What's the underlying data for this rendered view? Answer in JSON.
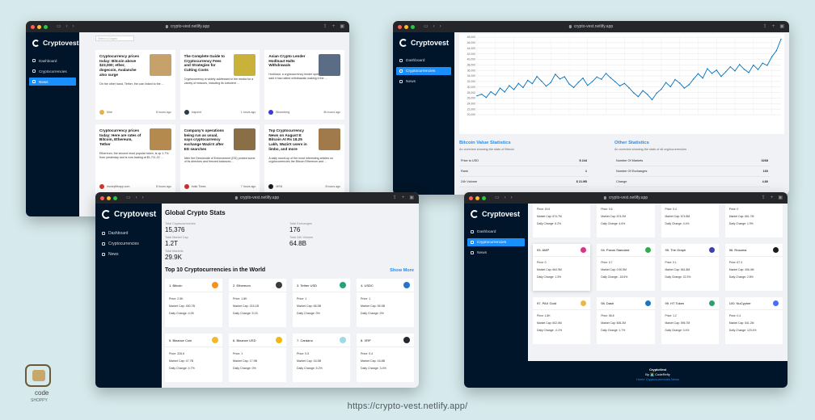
{
  "site_url": "https://crypto-vest.netlify.app/",
  "badge": {
    "label": "code",
    "sub": "SHOPPY"
  },
  "browser": {
    "url": "crypto-vest.netlify.app"
  },
  "brand": "Cryptovest",
  "menu": {
    "dashboard": "Dashboard",
    "cryptocurrencies": "Cryptocurrencies",
    "news": "News"
  },
  "news": {
    "select_placeholder": "Select a Crypto",
    "cards": [
      {
        "title": "Cryptocurrency prices today: Bitcoin above $23,000; ether, dogecoin, Avalanche also surge",
        "desc": "On the other hand, Tether, the coin linked to the ...",
        "provider": "Mint",
        "time": "8 hours ago",
        "thumb": "#c7a16a",
        "pav": "#e8b04a"
      },
      {
        "title": "The Complete Guide to Cryptocurrency Fees and Strategies for Cutting Costs",
        "desc": "Cryptocurrency is widely addressed in the media for a variety of reasons, including its turbulent ...",
        "provider": "Inspoint",
        "time": "1 hours ago",
        "thumb": "#c9b23a",
        "pav": "#2d3a48"
      },
      {
        "title": "Asian Crypto Lender Hodlnaut Halts Withdrawals",
        "desc": "Hodlnaut, a cryptocurrency lender operating in Asia, said it has halted withdrawals making it the ...",
        "provider": "Bloomberg",
        "time": "8h hours ago",
        "thumb": "#5a6d84",
        "pav": "#3b3bd6"
      },
      {
        "title": "Cryptocurrency prices today: Here are rates of Bitcoin, Ethereum, Tether",
        "desc": "Ethereum, the second most popular token, is up 1.7% from yesterday and is now trading at $1,711.22 ...",
        "provider": "moneylifeapp.com",
        "time": "8 hours ago",
        "thumb": "#b58a4e",
        "pav": "#d03a2a"
      },
      {
        "title": "Company's operations being run as usual, says cryptocurrency exchange WazirX after ED searches",
        "desc": "After the Directorate of Enforcement (ED) probed some of its directors and freezed balances ...",
        "provider": "India Times",
        "time": "7 hours ago",
        "thumb": "#8a6e45",
        "pav": "#c7332c"
      },
      {
        "title": "Top Cryptocurrency News on August 8: Bitcoin At Rs 18.25 Lakh, WazirX users in limbo, and more",
        "desc": "A daily round-up of the most interesting articles on cryptocurrencies the Bitcoin Ethereum and ...",
        "provider": "MSN",
        "time": "8 hours ago",
        "thumb": "#a07a4a",
        "pav": "#1a1a1a"
      }
    ]
  },
  "chart_data": {
    "type": "line",
    "title": "",
    "xlabel": "",
    "ylabel": "",
    "ylim": [
      20000,
      48000
    ],
    "yticks": [
      "48,000",
      "46,000",
      "44,000",
      "42,000",
      "40,000",
      "38,000",
      "36,000",
      "34,000",
      "32,000",
      "30,000",
      "28,000",
      "26,000",
      "24,000",
      "22,000",
      "20,000"
    ],
    "series": [
      {
        "values": [
          26800,
          27400,
          26200,
          28300,
          27100,
          29600,
          28200,
          30500,
          29100,
          31300,
          29800,
          32400,
          31200,
          33800,
          32100,
          30300,
          31600,
          34600,
          32900,
          33700,
          31100,
          29800,
          31700,
          33200,
          30600,
          31900,
          33600,
          32800,
          34900,
          33300,
          31900,
          30400,
          31300,
          29700,
          27900,
          26500,
          28700,
          27300,
          25400,
          27800,
          29200,
          31600,
          30100,
          32700,
          31400,
          29600,
          30800,
          32900,
          34800,
          33200,
          36600,
          34900,
          36100,
          33800,
          35500,
          37300,
          35800,
          38100,
          36400,
          35200,
          37900,
          36300,
          38600,
          37800,
          40900,
          43100,
          47300
        ]
      }
    ]
  },
  "bitcoin_stats": {
    "title": "Bitcoin Value Statistics",
    "subtitle": "An overview showing the stats of Bitcoin",
    "rows": [
      {
        "label": "Price to USD",
        "value": "$ 244"
      },
      {
        "label": "Rank",
        "value": "1"
      },
      {
        "label": "24h Volume",
        "value": "$ 21.9B"
      }
    ]
  },
  "other_stats": {
    "title": "Other Statistics",
    "subtitle": "An overview showing the stats of all cryptocurrencies",
    "rows": [
      {
        "label": "Number Of Markets",
        "value": "3268"
      },
      {
        "label": "Number Of Exchanges",
        "value": "160"
      },
      {
        "label": "Change",
        "value": "4.80"
      }
    ]
  },
  "global": {
    "title": "Global Crypto Stats",
    "total_crypto_label": "Total Cryptocurrencies",
    "total_crypto": "15,376",
    "total_exchanges_label": "Total Exchanges",
    "total_exchanges": "176",
    "total_mcap_label": "Total Market Cap",
    "total_mcap": "1.2T",
    "total_24h_label": "Total 24h Volume",
    "total_24h": "64.8B",
    "total_markets_label": "Total Markets",
    "total_markets": "29.9K",
    "top10_title": "Top 10 Cryptocurrencies in the World",
    "show_more": "Show More",
    "coins": [
      {
        "name": "1. Bitcoin",
        "price": "Price: 2.5K",
        "mcap": "Market Cap: 450.7B",
        "change": "Daily Change: 4.05",
        "color": "#f7931a"
      },
      {
        "name": "2. Ethereum",
        "price": "Price: 1.8K",
        "mcap": "Market Cap: 215.1B",
        "change": "Daily Change: 5.15",
        "color": "#3c3c3d"
      },
      {
        "name": "3. Tether USD",
        "price": "Price: 1",
        "mcap": "Market Cap: 66.5B",
        "change": "Daily Change: 0%",
        "color": "#26a17b"
      },
      {
        "name": "4. USDC",
        "price": "Price: 1",
        "mcap": "Market Cap: 55.9B",
        "change": "Daily Change: 0%",
        "color": "#2775ca"
      },
      {
        "name": "5. Binance Coin",
        "price": "Price: 326.6",
        "mcap": "Market Cap: 47.7B",
        "change": "Daily Change: 4.7%",
        "color": "#f3ba2f"
      },
      {
        "name": "6. Binance USD",
        "price": "Price: 1",
        "mcap": "Market Cap: 17.9B",
        "change": "Daily Change: 0%",
        "color": "#f0b90b"
      },
      {
        "name": "7. Cardano",
        "price": "Price: 0.5",
        "mcap": "Market Cap: 16.5B",
        "change": "Daily Change: 5.2%",
        "color": "#9ed9e6"
      },
      {
        "name": "8. XRP",
        "price": "Price: 0.4",
        "mcap": "Market Cap: 16.8B",
        "change": "Daily Change: 3.4%",
        "color": "#23292f"
      }
    ]
  },
  "top100": {
    "cards": [
      {
        "name": "",
        "price": "Price: 15.6",
        "mcap": "Market Cap: 674.7M",
        "change": "Daily Change: 6.2%",
        "color": "",
        "top": true
      },
      {
        "name": "",
        "price": "Price: 0.6",
        "mcap": "Market Cap: 674.2M",
        "change": "Daily Change: 4.6%",
        "color": "",
        "top": true
      },
      {
        "name": "",
        "price": "Price: 0.4",
        "mcap": "Market Cap: 674.8M",
        "change": "Daily Change: 4.4%",
        "color": "",
        "top": true
      },
      {
        "name": "",
        "price": "Price: 0",
        "mcap": "Market Cap: 661.7M",
        "change": "Daily Change: 1.9%",
        "color": "",
        "top": true
      },
      {
        "name": "93. AMP",
        "price": "Price: 0",
        "mcap": "Market Cap: 664.9M",
        "change": "Daily Change: 1.3%",
        "color": "#d9348b",
        "hl": true
      },
      {
        "name": "94. Paxos Standard",
        "price": "Price: 0.7",
        "mcap": "Market Cap: 0.50.5M",
        "change": "Daily Change: -18.6%",
        "color": "#34a853"
      },
      {
        "name": "95. The Graph",
        "price": "Price: 0.1",
        "mcap": "Market Cap: 661.8M",
        "change": "Daily Change: 22.3%",
        "color": "#3f3fb5"
      },
      {
        "name": "96. Rosama",
        "price": "Price: 67.3",
        "mcap": "Market Cap: 406.4M",
        "change": "Daily Change: 2.8%",
        "color": "#1b1b1b"
      },
      {
        "name": "97. PAX Gold",
        "price": "Price: 1.8K",
        "mcap": "Market Cap: 602.6M",
        "change": "Daily Change: -0.2%",
        "color": "#e8b84a"
      },
      {
        "name": "98. Dash",
        "price": "Price: 56.8",
        "mcap": "Market Cap: 606.2M",
        "change": "Daily Change: 1.7%",
        "color": "#1c75bc"
      },
      {
        "name": "99. HT Token",
        "price": "Price: 1.2",
        "mcap": "Market Cap: 596.7M",
        "change": "Daily Change: 0.4%",
        "color": "#2ea06e"
      },
      {
        "name": "100. NuCypher",
        "price": "Price: 0.4",
        "mcap": "Market Cap: 541.2M",
        "change": "Daily Change: 123.4%",
        "color": "#4a6cf7"
      }
    ],
    "footer_title": "CryptoVest",
    "footer_by": "By 👩‍💻 CodeRefly",
    "footer_links": "Home Cryptocurrencies News"
  }
}
